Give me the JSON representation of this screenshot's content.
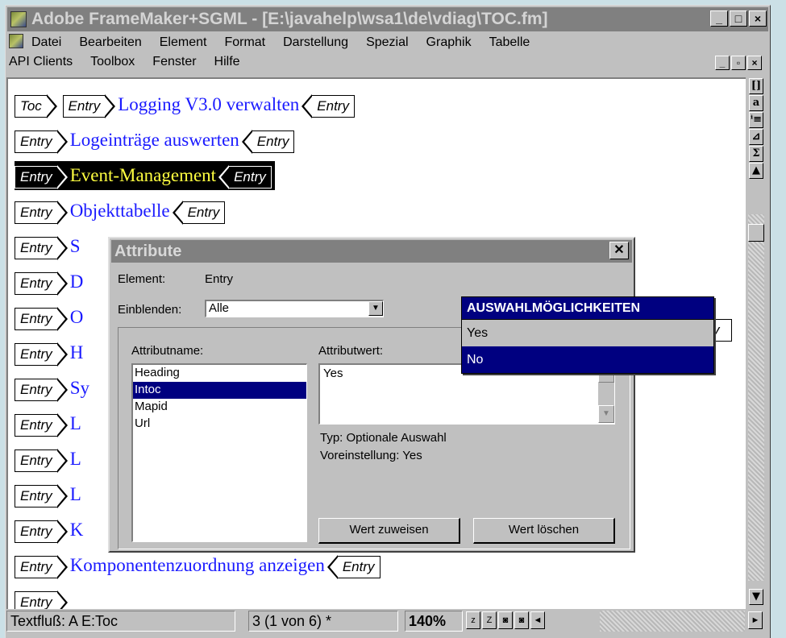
{
  "window": {
    "title": "Adobe FrameMaker+SGML - [E:\\javahelp\\wsa1\\de\\vdiag\\TOC.fm]",
    "minimize": "_",
    "maximize": "□",
    "close": "×"
  },
  "menubar": {
    "row1": [
      "Datei",
      "Bearbeiten",
      "Element",
      "Format",
      "Darstellung",
      "Spezial",
      "Graphik",
      "Tabelle"
    ],
    "row2": [
      "API Clients",
      "Toolbox",
      "Fenster",
      "Hilfe"
    ]
  },
  "document": {
    "root_tag": "Toc",
    "entry_tag": "Entry",
    "lines": [
      {
        "text": "Logging V3.0 verwalten",
        "selected": false
      },
      {
        "text": "Logeinträge auswerten",
        "selected": false
      },
      {
        "text": "Event-Management",
        "selected": true
      },
      {
        "text": "Objekttabelle",
        "selected": false
      },
      {
        "text": "S",
        "selected": false
      },
      {
        "text": "D",
        "selected": false
      },
      {
        "text": "O",
        "selected": false
      },
      {
        "text": "H",
        "selected": false
      },
      {
        "text": "Sy",
        "selected": false
      },
      {
        "text": "L",
        "selected": false
      },
      {
        "text": "L",
        "selected": false
      },
      {
        "text": "L",
        "selected": false
      },
      {
        "text": "K",
        "selected": false
      },
      {
        "text": "Komponentenzuordnung anzeigen",
        "selected": false
      }
    ]
  },
  "side_tools": [
    "[]",
    "a",
    "ⁱ≡",
    "⊿",
    "Σ",
    "▲"
  ],
  "statusbar": {
    "flow": "Textfluß: A  E:Toc",
    "page": "3 (1 von 6) *",
    "zoom": "140%",
    "buttons": [
      "z",
      "Z",
      "◙",
      "◙",
      "◄"
    ],
    "right_arrow": "►"
  },
  "dialog": {
    "title": "Attribute",
    "element_label": "Element:",
    "element_value": "Entry",
    "show_label": "Einblenden:",
    "show_value": "Alle",
    "attrname_label": "Attributname:",
    "attrvalue_label": "Attributwert:",
    "attributes": [
      "Heading",
      "Intoc",
      "Mapid",
      "Url"
    ],
    "selected_attribute": "Intoc",
    "value": "Yes",
    "type_text": "Typ: Optionale Auswahl",
    "default_text": "Voreinstellung: Yes",
    "assign_button": "Wert zuweisen",
    "delete_button": "Wert löschen"
  },
  "popup": {
    "header": "AUSWAHLMÖGLICHKEITEN",
    "options": [
      "Yes",
      "No"
    ],
    "selected": "No"
  },
  "colors": {
    "entry_text": "#1a1aff",
    "selected_text": "#ffff40",
    "selection_bg": "#000080"
  }
}
